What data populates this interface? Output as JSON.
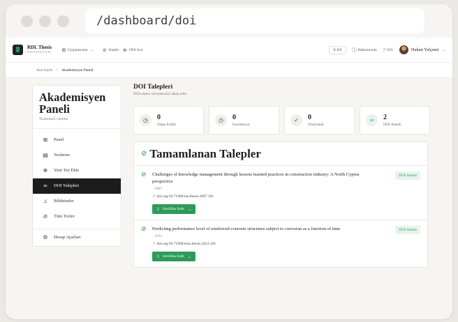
{
  "browser": {
    "url": "/dashboard/doi"
  },
  "topnav": {
    "brand_name": "RDL Thesis",
    "brand_sub": "EKOSİSTEM",
    "apps_label": "Uygulamalar",
    "explore_label": "Keşfet",
    "doi_search_label": "DOI Ara",
    "lang_label": "EN",
    "about_label": "Hakkımızda",
    "faq_label": "SSS",
    "user_name": "Hakan Yalçıner"
  },
  "breadcrumb": {
    "home": "Ana Sayfa",
    "separator": ">",
    "current": "Akademisyen Paneli"
  },
  "sidebar": {
    "title": "Akademisyen Paneli",
    "subtitle": "Tezlerinizi yönetin",
    "items": [
      {
        "label": "Panel",
        "icon": "grid-icon",
        "active": false
      },
      {
        "label": "Tezlerim",
        "icon": "document-icon",
        "active": false
      },
      {
        "label": "Yeni Tez Ekle",
        "icon": "plus-circle-icon",
        "active": false
      },
      {
        "label": "DOI Talepleri",
        "icon": "link-icon",
        "active": true
      },
      {
        "label": "Bildirimler",
        "icon": "bell-icon",
        "active": false
      },
      {
        "label": "Tüm Tezler",
        "icon": "compass-icon",
        "active": false
      }
    ],
    "settings_label": "Hesap Ayarları"
  },
  "main": {
    "title": "DOI Talepleri",
    "subtitle": "DOI atama süreçlerinizi takip edin",
    "stats": [
      {
        "value": "0",
        "label": "Talep Edildi",
        "icon": "clock-icon"
      },
      {
        "value": "0",
        "label": "İnceleniyor",
        "icon": "clock-icon"
      },
      {
        "value": "0",
        "label": "Onaylandı",
        "icon": "check-circle-icon"
      },
      {
        "value": "2",
        "label": "DOI Atandı",
        "icon": "link-icon"
      }
    ],
    "completed": {
      "title": "Tamamlanan Talepler",
      "requests": [
        {
          "title": "Challenges of knowledge management through lessons learned practices in construction industry: A North Cyprus perspective",
          "year": "· 2007",
          "doi": "doi.org/10.71008/ias.thesis.2007.101",
          "badge": "DOI Atandı",
          "button": "Sertifika İndir"
        },
        {
          "title": "Predicting performance level of reinforced concrete structures subject to corrosion as a function of time",
          "year": "· 2012",
          "doi": "doi.org/10.71008/emu.thesis.2012.101",
          "badge": "DOI Atandı",
          "button": "Sertifika İndir"
        }
      ]
    }
  },
  "colors": {
    "accent": "#2e9a5a",
    "active_nav": "#1c1c1c",
    "background": "#f6f5f2"
  }
}
